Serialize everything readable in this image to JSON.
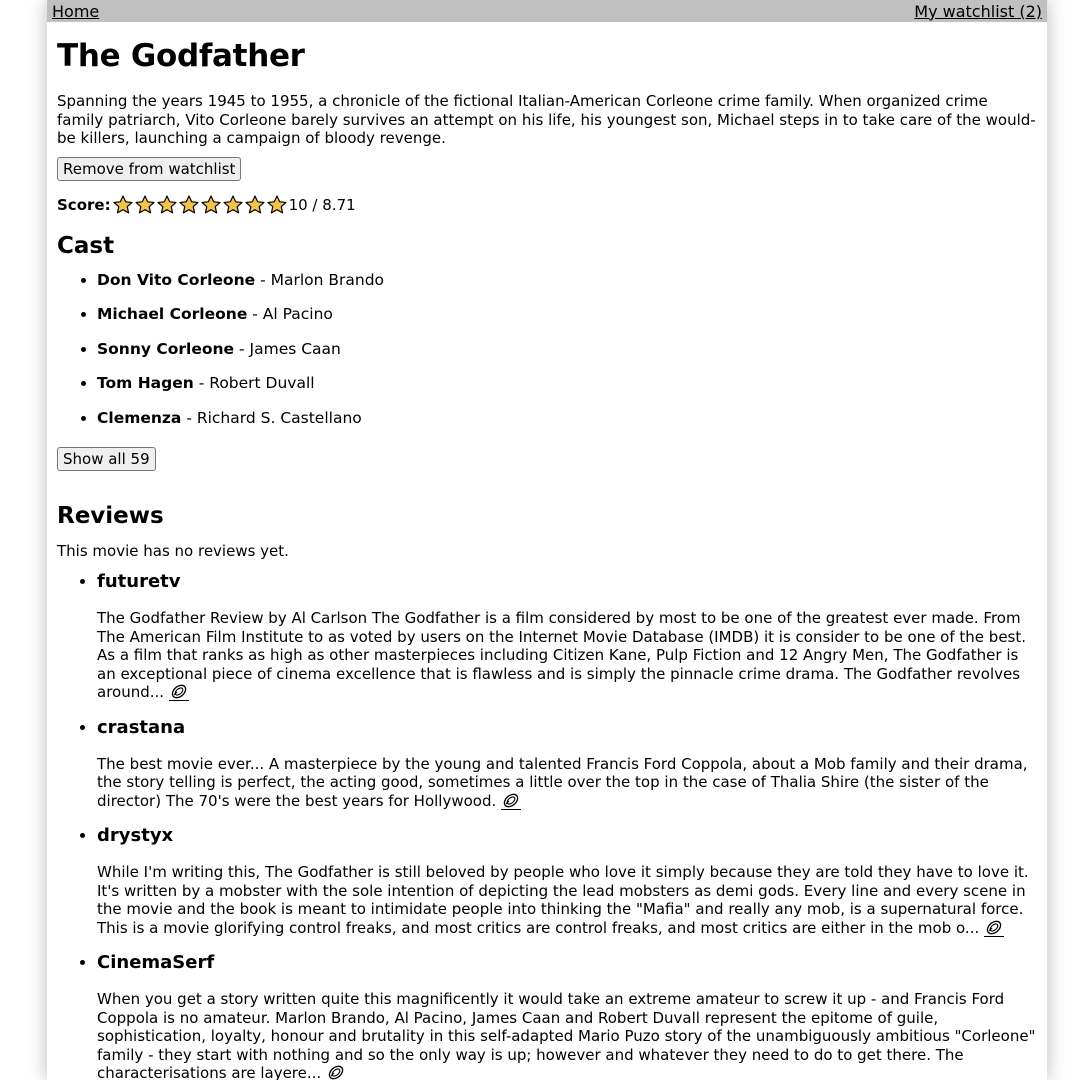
{
  "nav": {
    "home_label": "Home",
    "watchlist_label": "My watchlist (2)"
  },
  "movie": {
    "title": "The Godfather",
    "overview": "Spanning the years 1945 to 1955, a chronicle of the fictional Italian-American Corleone crime family. When organized crime family patriarch, Vito Corleone barely survives an attempt on his life, his youngest son, Michael steps in to take care of the would-be killers, launching a campaign of bloody revenge.",
    "watchlist_button": "Remove from watchlist",
    "score_label": "Score:",
    "stars_filled": 8,
    "stars_total": 8,
    "score_value": "10 / 8.71",
    "star_color": "#f5c542"
  },
  "cast": {
    "heading": "Cast",
    "members": [
      {
        "character": "Don Vito Corleone",
        "actor": " - Marlon Brando"
      },
      {
        "character": "Michael Corleone",
        "actor": " - Al Pacino"
      },
      {
        "character": "Sonny Corleone",
        "actor": " - James Caan"
      },
      {
        "character": "Tom Hagen",
        "actor": " - Robert Duvall"
      },
      {
        "character": "Clemenza",
        "actor": " - Richard S. Castellano"
      }
    ],
    "show_all_button": "Show all 59"
  },
  "reviews": {
    "heading": "Reviews",
    "empty_text": "This movie has no reviews yet.",
    "items": [
      {
        "author": "futuretv",
        "body": "The Godfather Review by Al Carlson  The Godfather is a film considered by most to be one of the greatest ever made. From The American Film Institute to as voted by users on the Internet Movie Database (IMDB) it is consider to be one of the best. As a film that ranks as high as other masterpieces including Citizen Kane, Pulp Fiction and 12 Angry Men, The Godfather is an exceptional piece of cinema excellence that is flawless and is simply the pinnacle crime drama. The Godfather revolves around... "
      },
      {
        "author": "crastana",
        "body": "The best movie ever... A masterpiece by the young and talented Francis Ford Coppola, about a Mob family and their drama, the story telling is perfect, the acting good, sometimes a little over the top in the case of Thalia Shire (the sister of the director)  The 70's were the best years for Hollywood. "
      },
      {
        "author": "drystyx",
        "body": "While I'm writing this, The Godfather is still beloved by people who love it simply because they are told they have to love it.  It's written by a mobster with the sole intention of depicting the lead mobsters as demi gods. Every line and every scene in the movie and the book is meant to intimidate people into thinking the \"Mafia\" and really any mob, is a supernatural force. This is a movie glorifying control freaks, and most critics are control freaks, and most critics are either in the mob o... "
      },
      {
        "author": "CinemaSerf",
        "body": "When you get a story written quite this magnificently it would take an extreme amateur to screw it up - and Francis Ford Coppola is no amateur. Marlon Brando, Al Pacino, James Caan and Robert Duvall represent the epitome of guile, sophistication, loyalty, honour and brutality in this self-adapted Mario Puzo story of the unambiguously ambitious \"Corleone\" family - they start with nothing and so the only way is up; however and whatever they need to do to get there. The characterisations are layere... "
      }
    ]
  }
}
